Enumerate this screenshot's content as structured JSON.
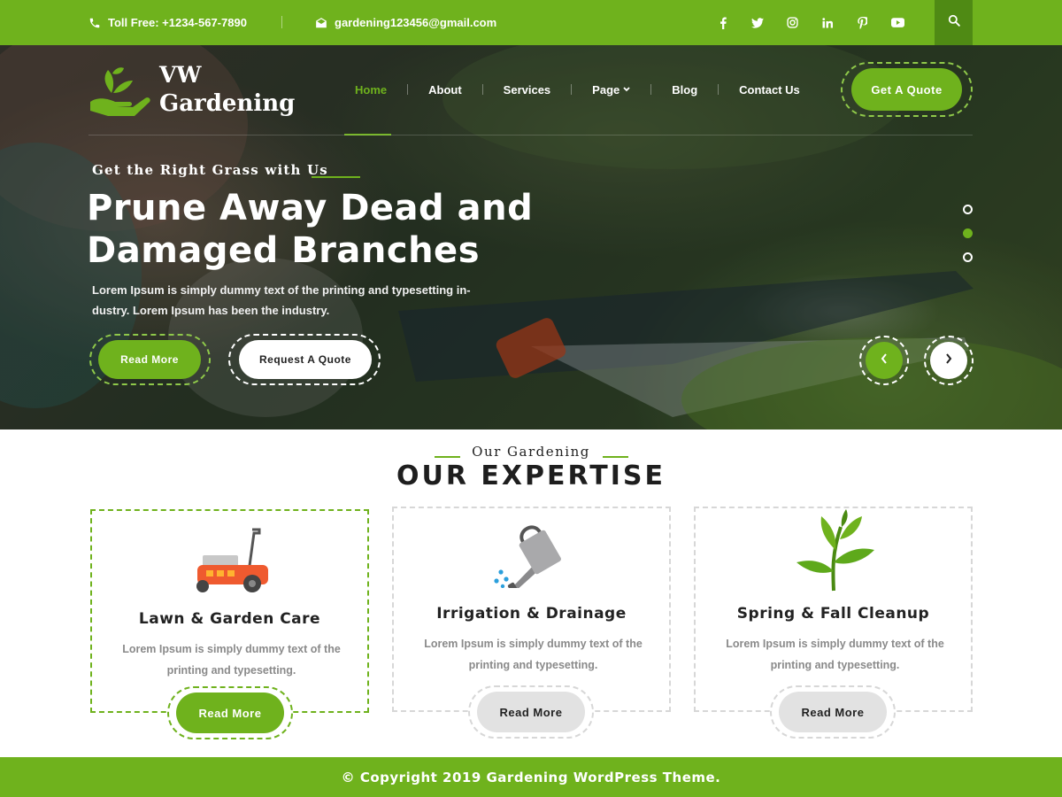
{
  "topbar": {
    "phone": "Toll Free: +1234-567-7890",
    "email": "gardening123456@gmail.com",
    "social_icons": [
      "facebook-icon",
      "twitter-icon",
      "instagram-icon",
      "linkedin-icon",
      "pinterest-icon",
      "youtube-icon"
    ],
    "search_icon": "search-icon"
  },
  "brand": {
    "line1": "VW",
    "line2": "Gardening",
    "logo_icon": "hand-with-leaves-icon"
  },
  "nav": {
    "items": [
      {
        "label": "Home",
        "active": true
      },
      {
        "label": "About"
      },
      {
        "label": "Services"
      },
      {
        "label": "Page",
        "dropdown": true
      },
      {
        "label": "Blog"
      },
      {
        "label": "Contact Us"
      }
    ],
    "cta": "Get A Quote"
  },
  "hero": {
    "eyebrow": "Get the Right Grass with Us",
    "title_line1": "Prune Away Dead and",
    "title_line2": "Damaged Branches",
    "lead": "Lorem Ipsum is simply dummy text of the printing and typesetting in-dustry. Lorem Ipsum has been the industry.",
    "btn_primary": "Read More",
    "btn_secondary": "Request A Quote",
    "slides_count": 3,
    "active_slide": 2,
    "prev_icon": "chevron-left-icon",
    "next_icon": "chevron-right-icon"
  },
  "expertise": {
    "eyebrow": "Our Gardening",
    "title": "OUR EXPERTISE",
    "cards": [
      {
        "icon": "lawn-mower-icon",
        "title": "Lawn & Garden Care",
        "text": "Lorem Ipsum is simply dummy text of the printing and typesetting.",
        "button": "Read More",
        "active": true
      },
      {
        "icon": "watering-can-icon",
        "title": "Irrigation & Drainage",
        "text": "Lorem Ipsum is simply dummy text of the printing and typesetting.",
        "button": "Read More",
        "active": false
      },
      {
        "icon": "plant-sprout-icon",
        "title": "Spring & Fall Cleanup",
        "text": "Lorem Ipsum is simply dummy text of the printing and typesetting.",
        "button": "Read More",
        "active": false
      }
    ]
  },
  "footer": {
    "copyright": "© Copyright 2019 Gardening WordPress Theme."
  },
  "colors": {
    "brand_green": "#6fb21d",
    "dark_green": "#4f8a14",
    "card_border": "#d7d7d7",
    "text_dark": "#222222",
    "text_muted": "#8a8a8a"
  }
}
